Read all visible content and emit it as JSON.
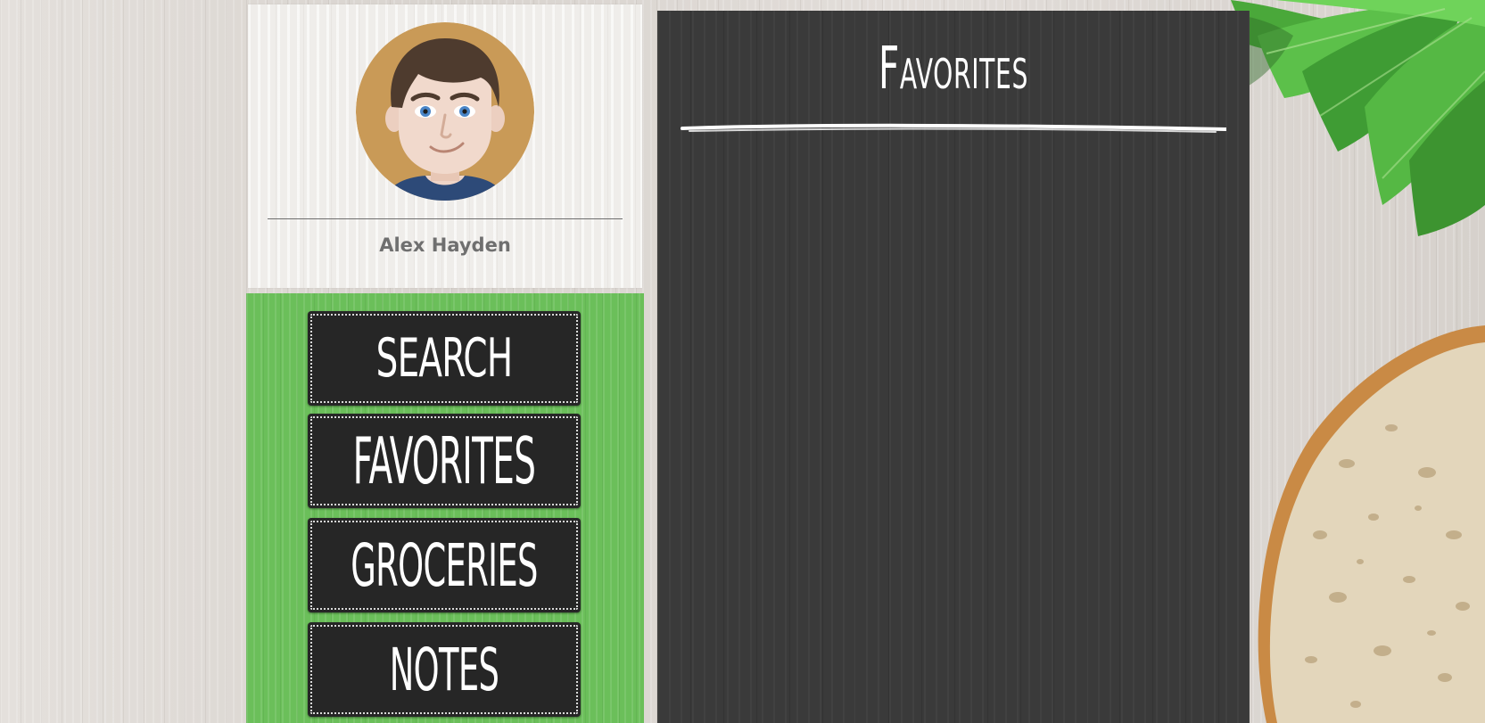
{
  "user": {
    "name": "Alex Hayden"
  },
  "nav": {
    "items": [
      {
        "label": "SEARCH"
      },
      {
        "label": "FAVORITES"
      },
      {
        "label": "GROCERIES"
      },
      {
        "label": "NOTES"
      }
    ]
  },
  "main": {
    "title": "Favorites"
  },
  "colors": {
    "nav_panel": "#6bbf5a",
    "button_bg": "#262626",
    "board_bg": "#3a3a3a",
    "name_text": "#6f6f6f"
  },
  "icons": {
    "avatar": "avatar",
    "leaves": "herb-leaves-decoration",
    "bread": "bread-slice-decoration"
  }
}
